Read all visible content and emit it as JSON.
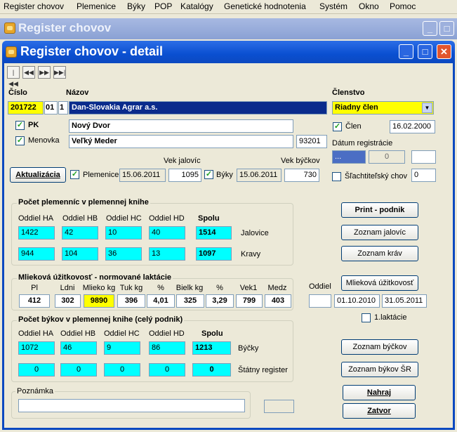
{
  "menu": [
    "Register chovov",
    "Plemenice",
    "Býky",
    "POP",
    "Katalógy",
    "Genetické hodnotenia",
    "Systém",
    "Okno",
    "Pomoc"
  ],
  "outer_window": {
    "title": "Register chovov"
  },
  "window": {
    "title": "Register chovov - detail"
  },
  "nav": [
    "first",
    "prev",
    "next",
    "last"
  ],
  "header": {
    "cislo_label": "Číslo",
    "nazov_label": "Názov",
    "clenstvo_label": "Členstvo",
    "cislo": "201722",
    "sub1": "01",
    "sub2": "1",
    "nazov": "Dan-Slovakia Agrar a.s.",
    "clenstvo_value": "Riadny člen",
    "pk_label": "PK",
    "pk_value": "Nový Dvor",
    "menovka_label": "Menovka",
    "menovka_value": "Veľký Meder",
    "zip": "93201",
    "clen_label": "Člen",
    "clen_date": "16.02.2000",
    "datum_reg_label": "Dátum registrácie",
    "reg_a": "...",
    "reg_b": "0",
    "reg_c": "",
    "slacht_label": "Šľachtiteľský chov",
    "slacht_value": "0"
  },
  "update": {
    "button": "Aktualizácia",
    "plemenice_label": "Plemenice",
    "plemenice_date": "15.06.2011",
    "vek_jalovic_label": "Vek jalovíc",
    "vek_jalovic": "1095",
    "byky_label": "Býky",
    "byky_date": "15.06.2011",
    "vek_byckov_label": "Vek býčkov",
    "vek_byckov": "730"
  },
  "plemennic": {
    "title": "Počet plemenníc v plemennej knihe",
    "headers": [
      "Oddiel HA",
      "Oddiel HB",
      "Oddiel HC",
      "Oddiel HD",
      "Spolu"
    ],
    "rows": [
      {
        "label": "Jalovice",
        "values": [
          "1422",
          "42",
          "10",
          "40",
          "1514"
        ]
      },
      {
        "label": "Kravy",
        "values": [
          "944",
          "104",
          "36",
          "13",
          "1097"
        ]
      }
    ]
  },
  "mliekova": {
    "title": "Mlieková úžitkovosť - normované laktácie",
    "headers": [
      "Pl",
      "Ldni",
      "Mlieko kg",
      "Tuk kg",
      "%",
      "Bielk kg",
      "%",
      "Vek1",
      "Medz"
    ],
    "values": [
      "412",
      "302",
      "9890",
      "396",
      "4,01",
      "325",
      "3,29",
      "799",
      "403"
    ],
    "oddiel_label": "Oddiel",
    "oddiel_value": "",
    "date_from": "01.10.2010",
    "date_to": "31.05.2011",
    "laktacia_label": "1.laktácie"
  },
  "bykov": {
    "title": "Počet býkov v plemennej knihe (celý podnik)",
    "headers": [
      "Oddiel HA",
      "Oddiel HB",
      "Oddiel HC",
      "Oddiel HD",
      "Spolu"
    ],
    "rows": [
      {
        "label": "Býčky",
        "values": [
          "1072",
          "46",
          "9",
          "86",
          "1213"
        ]
      },
      {
        "label": "Štátny register",
        "values": [
          "0",
          "0",
          "0",
          "0",
          "0"
        ]
      }
    ]
  },
  "poznamka": {
    "label": "Poznámka",
    "value": ""
  },
  "buttons": {
    "print": "Print - podnik",
    "jalovic": "Zoznam jalovíc",
    "krav": "Zoznam kráv",
    "mliekova": "Mlieková úžitkovosť",
    "byckov": "Zoznam býčkov",
    "bykov_sr": "Zoznam býkov ŠR",
    "nahraj": "Nahraj",
    "zatvor": "Zatvor"
  },
  "colors": {
    "title_blue": "#0a4fd1",
    "highlight_cyan": "#00ffff",
    "highlight_yellow": "#ffff00",
    "name_navy": "#0a2b8c"
  },
  "icons": {
    "app": "app-icon",
    "minimize": "minimize-icon",
    "maximize": "maximize-icon",
    "close": "close-icon"
  }
}
